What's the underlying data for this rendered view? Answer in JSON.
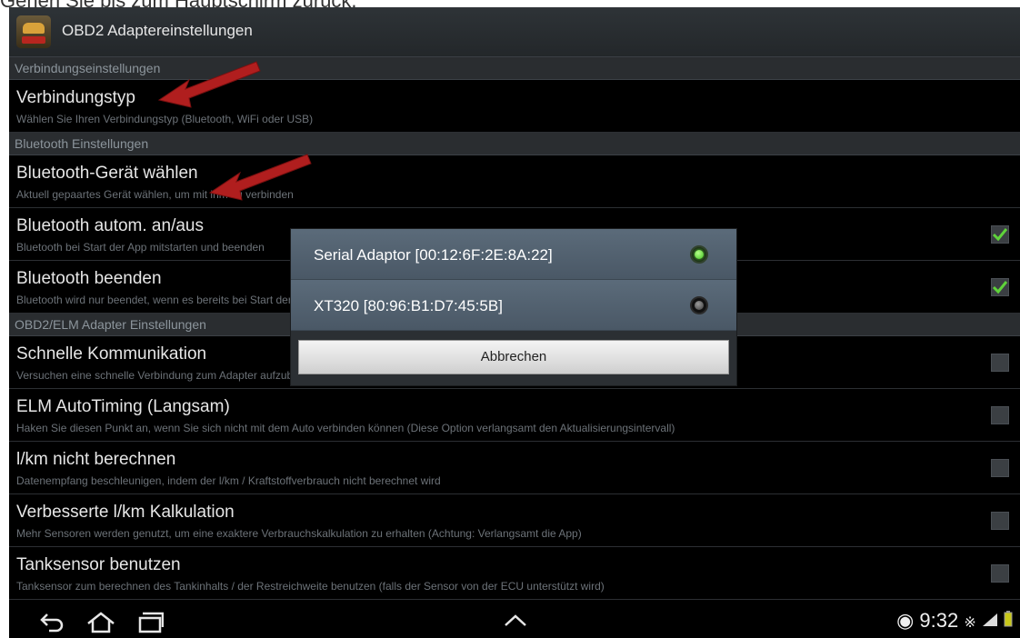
{
  "caption": "Gehen Sie bis zum Hauptschirm zurück.",
  "app": {
    "title": "OBD2 Adaptereinstellungen"
  },
  "sections": {
    "connection": "Verbindungseinstellungen",
    "bluetooth": "Bluetooth Einstellungen",
    "adapter": "OBD2/ELM Adapter Einstellungen"
  },
  "items": {
    "conn_type": {
      "title": "Verbindungstyp",
      "subtitle": "Wählen Sie Ihren Verbindungstyp (Bluetooth, WiFi oder USB)"
    },
    "bt_device": {
      "title": "Bluetooth-Gerät wählen",
      "subtitle": "Aktuell gepaartes Gerät wählen, um mit ihm zu verbinden"
    },
    "bt_auto": {
      "title": "Bluetooth autom. an/aus",
      "subtitle": "Bluetooth bei Start der App mitstarten und beenden",
      "checked": true
    },
    "bt_close": {
      "title": "Bluetooth beenden",
      "subtitle": "Bluetooth wird nur beendet, wenn es bereits bei Start der App nicht an war, ansonsten kann es nicht beendet werden",
      "checked": true
    },
    "fast_comm": {
      "title": "Schnelle Kommunikation",
      "subtitle": "Versuchen eine schnelle Verbindung zum Adapter aufzubauen (funktioniert nicht bei allen Geräten)",
      "checked": false
    },
    "elm_timing": {
      "title": "ELM AutoTiming (Langsam)",
      "subtitle": "Haken Sie diesen Punkt an, wenn Sie sich nicht mit dem Auto verbinden können (Diese Option verlangsamt den Aktualisierungsintervall)",
      "checked": false
    },
    "no_lkm": {
      "title": "l/km nicht berechnen",
      "subtitle": "Datenempfang beschleunigen, indem der l/km / Kraftstoffverbrauch nicht berechnet wird",
      "checked": false
    },
    "better_lkm": {
      "title": "Verbesserte l/km Kalkulation",
      "subtitle": "Mehr Sensoren werden genutzt, um eine exaktere Verbrauchskalkulation zu erhalten (Achtung: Verlangsamt die App)",
      "checked": false
    },
    "tank": {
      "title": "Tanksensor benutzen",
      "subtitle": "Tanksensor zum berechnen des Tankinhalts / der Restreichweite benutzen (falls der Sensor von der ECU unterstützt wird)",
      "checked": false
    }
  },
  "dialog": {
    "options": [
      {
        "label": "Serial Adaptor [00:12:6F:2E:8A:22]",
        "selected": true
      },
      {
        "label": "XT320 [80:96:B1:D7:45:5B]",
        "selected": false
      }
    ],
    "cancel_label": "Abbrechen"
  },
  "statusbar": {
    "time": "9:32"
  },
  "icons": {
    "nav": [
      "back-icon",
      "home-icon",
      "recent-apps-icon",
      "chevron-up-icon"
    ],
    "status": [
      "adapter-status-icon",
      "bluetooth-icon",
      "signal-icon",
      "battery-icon"
    ]
  },
  "colors": {
    "accent_green": "#5fd33a",
    "annotation_arrow": "#b01e1e"
  }
}
